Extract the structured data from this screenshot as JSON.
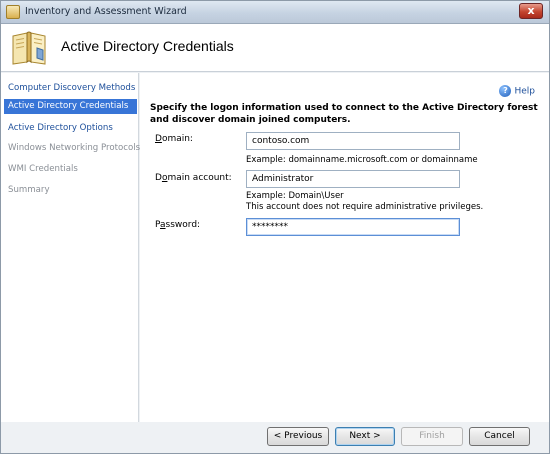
{
  "window": {
    "title": "Inventory and Assessment Wizard",
    "close_label": "x"
  },
  "header": {
    "title": "Active Directory Credentials",
    "icon": "book-icon"
  },
  "nav": {
    "items": [
      {
        "label": "Computer Discovery Methods",
        "state": "link"
      },
      {
        "label": "Active Directory Credentials",
        "state": "active"
      },
      {
        "label": "Active Directory Options",
        "state": "link"
      },
      {
        "label": "Windows Networking Protocols",
        "state": "disabled"
      },
      {
        "label": "WMI Credentials",
        "state": "disabled"
      },
      {
        "label": "Summary",
        "state": "disabled"
      }
    ]
  },
  "help": {
    "label": "Help",
    "icon": "help-icon"
  },
  "instructions": "Specify the logon information used to connect to the Active Directory forest and discover domain joined computers.",
  "form": {
    "domain_label_mnemonic": "D",
    "domain_label_rest": "omain:",
    "domain_value": "contoso.com",
    "domain_hint": "Example: domainname.microsoft.com or domainname",
    "account_label_pre": "D",
    "account_label_mnemonic": "o",
    "account_label_rest": "main account:",
    "account_value": "Administrator",
    "account_hint_1": "Example: Domain\\User",
    "account_hint_2": "This account does not require administrative privileges.",
    "password_label_pre": "P",
    "password_label_mnemonic": "a",
    "password_label_rest": "ssword:",
    "password_value": "********"
  },
  "footer": {
    "previous_label": "< Previous",
    "next_label": "Next >",
    "finish_label": "Finish",
    "cancel_label": "Cancel"
  },
  "colors": {
    "nav_active": "#3875d7",
    "link": "#1c4e9a"
  }
}
